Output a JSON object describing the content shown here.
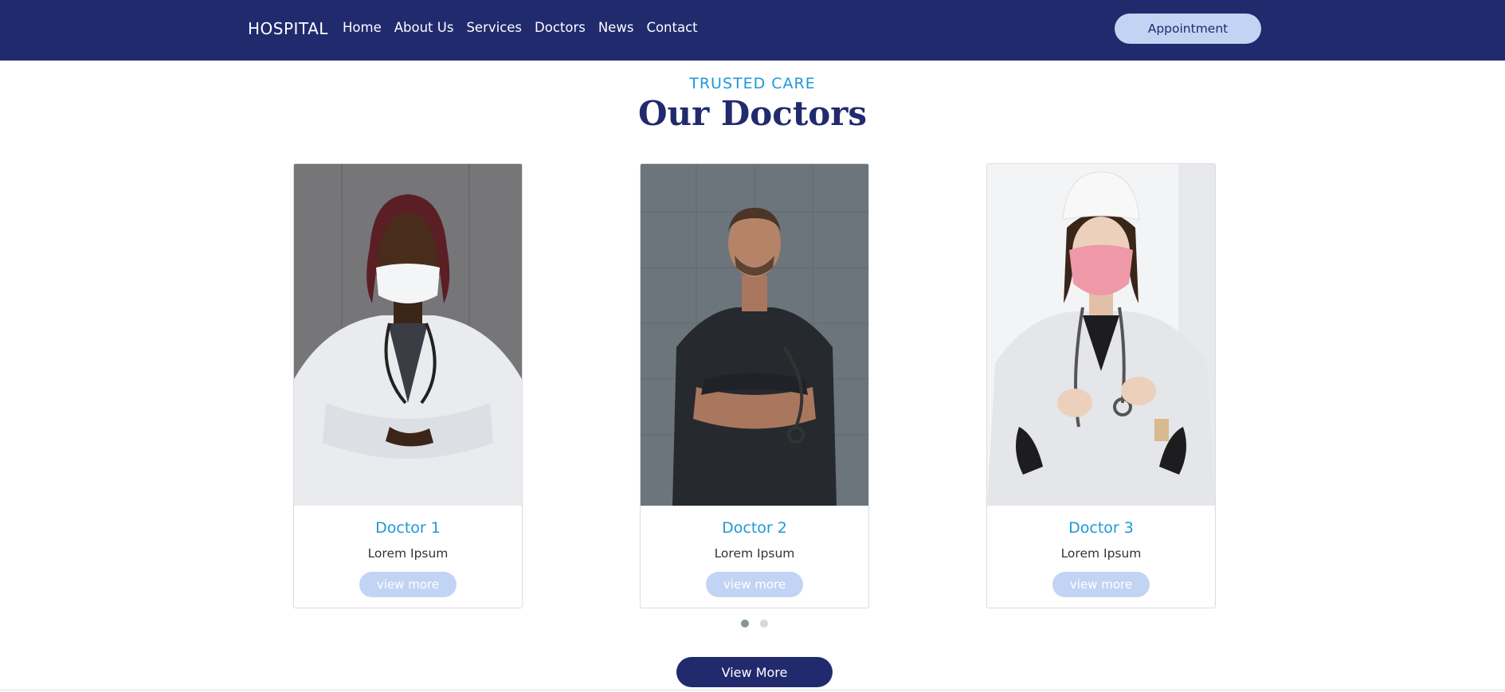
{
  "header": {
    "brand": "HOSPITAL",
    "nav": [
      "Home",
      "About Us",
      "Services",
      "Doctors",
      "News",
      "Contact"
    ],
    "appointment_label": "Appointment"
  },
  "section": {
    "eyebrow": "TRUSTED CARE",
    "title": "Our Doctors"
  },
  "doctors": [
    {
      "name": "Doctor 1",
      "role": "Lorem Ipsum",
      "button": "view more",
      "photo": "female-doctor-white-mask-photo"
    },
    {
      "name": "Doctor 2",
      "role": "Lorem Ipsum",
      "button": "view more",
      "photo": "male-doctor-dark-scrubs-photo"
    },
    {
      "name": "Doctor 3",
      "role": "Lorem Ipsum",
      "button": "view more",
      "photo": "female-doctor-pink-mask-photo"
    }
  ],
  "carousel": {
    "pages": 2,
    "active_page": 1
  },
  "view_more_label": "View More",
  "colors": {
    "navy": "#212a6d",
    "accent_blue": "#1e98d7",
    "light_blue": "#c2d4f4"
  }
}
